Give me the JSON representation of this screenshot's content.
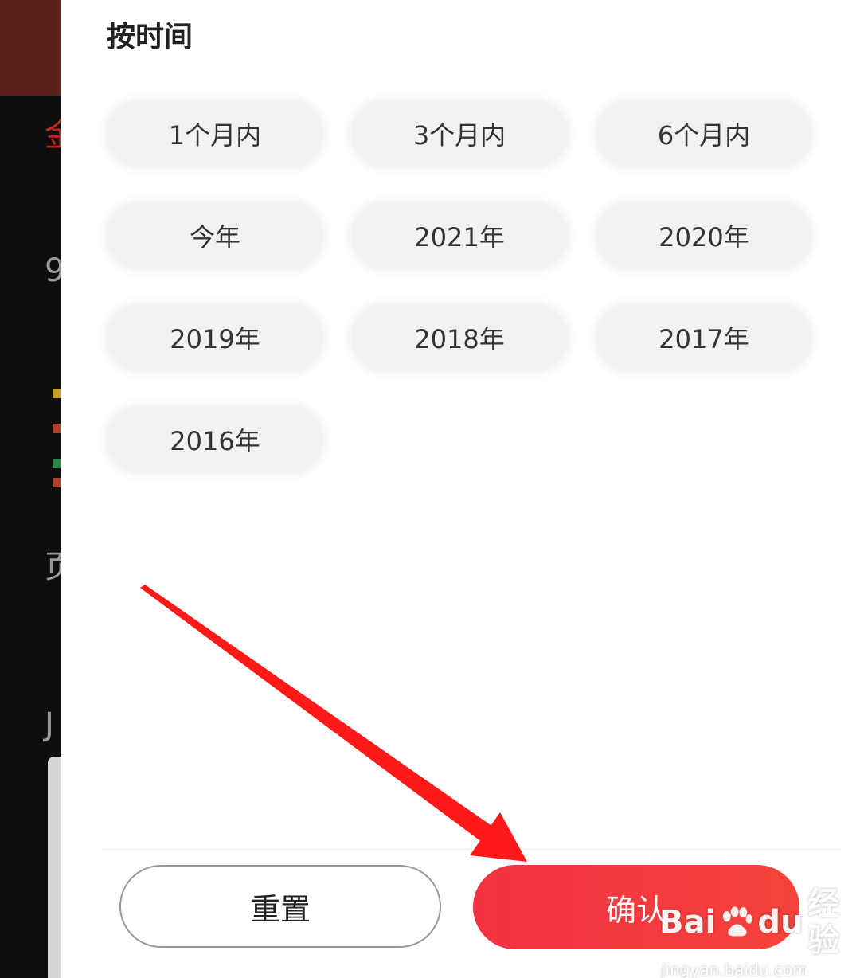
{
  "filter": {
    "title": "按时间",
    "options": [
      {
        "label": "1个月内"
      },
      {
        "label": "3个月内"
      },
      {
        "label": "6个月内"
      },
      {
        "label": "今年"
      },
      {
        "label": "2021年"
      },
      {
        "label": "2020年"
      },
      {
        "label": "2019年"
      },
      {
        "label": "2018年"
      },
      {
        "label": "2017年"
      },
      {
        "label": "2016年"
      }
    ]
  },
  "actions": {
    "reset_label": "重置",
    "confirm_label": "确认"
  },
  "watermark": {
    "brand_a": "Bai",
    "brand_b": "du",
    "brand_c": "经验",
    "url": "jingyan.baidu.com"
  },
  "colors": {
    "accent": "#f33142",
    "arrow": "#ff1a1a",
    "chip_bg": "#f2f2f2"
  }
}
